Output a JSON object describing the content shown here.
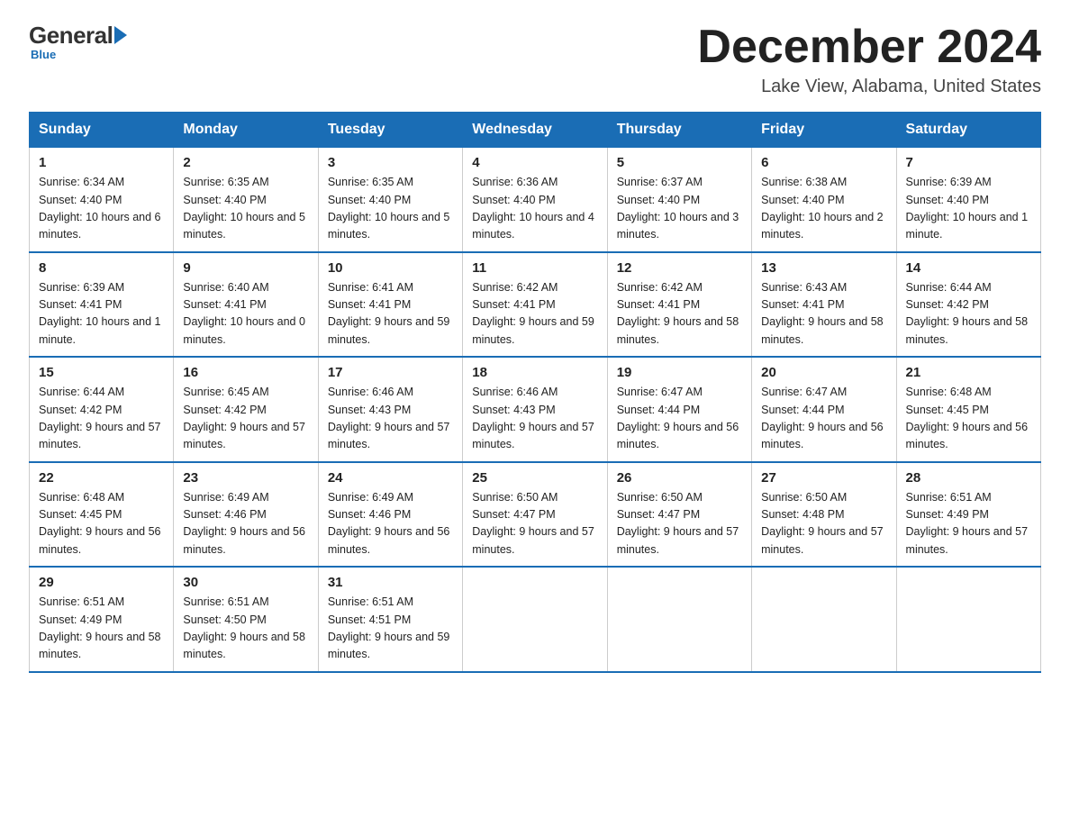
{
  "logo": {
    "general": "General",
    "blue": "Blue",
    "subtitle": "Blue"
  },
  "header": {
    "month": "December 2024",
    "location": "Lake View, Alabama, United States"
  },
  "days_of_week": [
    "Sunday",
    "Monday",
    "Tuesday",
    "Wednesday",
    "Thursday",
    "Friday",
    "Saturday"
  ],
  "weeks": [
    [
      {
        "day": "1",
        "sunrise": "6:34 AM",
        "sunset": "4:40 PM",
        "daylight": "10 hours and 6 minutes."
      },
      {
        "day": "2",
        "sunrise": "6:35 AM",
        "sunset": "4:40 PM",
        "daylight": "10 hours and 5 minutes."
      },
      {
        "day": "3",
        "sunrise": "6:35 AM",
        "sunset": "4:40 PM",
        "daylight": "10 hours and 5 minutes."
      },
      {
        "day": "4",
        "sunrise": "6:36 AM",
        "sunset": "4:40 PM",
        "daylight": "10 hours and 4 minutes."
      },
      {
        "day": "5",
        "sunrise": "6:37 AM",
        "sunset": "4:40 PM",
        "daylight": "10 hours and 3 minutes."
      },
      {
        "day": "6",
        "sunrise": "6:38 AM",
        "sunset": "4:40 PM",
        "daylight": "10 hours and 2 minutes."
      },
      {
        "day": "7",
        "sunrise": "6:39 AM",
        "sunset": "4:40 PM",
        "daylight": "10 hours and 1 minute."
      }
    ],
    [
      {
        "day": "8",
        "sunrise": "6:39 AM",
        "sunset": "4:41 PM",
        "daylight": "10 hours and 1 minute."
      },
      {
        "day": "9",
        "sunrise": "6:40 AM",
        "sunset": "4:41 PM",
        "daylight": "10 hours and 0 minutes."
      },
      {
        "day": "10",
        "sunrise": "6:41 AM",
        "sunset": "4:41 PM",
        "daylight": "9 hours and 59 minutes."
      },
      {
        "day": "11",
        "sunrise": "6:42 AM",
        "sunset": "4:41 PM",
        "daylight": "9 hours and 59 minutes."
      },
      {
        "day": "12",
        "sunrise": "6:42 AM",
        "sunset": "4:41 PM",
        "daylight": "9 hours and 58 minutes."
      },
      {
        "day": "13",
        "sunrise": "6:43 AM",
        "sunset": "4:41 PM",
        "daylight": "9 hours and 58 minutes."
      },
      {
        "day": "14",
        "sunrise": "6:44 AM",
        "sunset": "4:42 PM",
        "daylight": "9 hours and 58 minutes."
      }
    ],
    [
      {
        "day": "15",
        "sunrise": "6:44 AM",
        "sunset": "4:42 PM",
        "daylight": "9 hours and 57 minutes."
      },
      {
        "day": "16",
        "sunrise": "6:45 AM",
        "sunset": "4:42 PM",
        "daylight": "9 hours and 57 minutes."
      },
      {
        "day": "17",
        "sunrise": "6:46 AM",
        "sunset": "4:43 PM",
        "daylight": "9 hours and 57 minutes."
      },
      {
        "day": "18",
        "sunrise": "6:46 AM",
        "sunset": "4:43 PM",
        "daylight": "9 hours and 57 minutes."
      },
      {
        "day": "19",
        "sunrise": "6:47 AM",
        "sunset": "4:44 PM",
        "daylight": "9 hours and 56 minutes."
      },
      {
        "day": "20",
        "sunrise": "6:47 AM",
        "sunset": "4:44 PM",
        "daylight": "9 hours and 56 minutes."
      },
      {
        "day": "21",
        "sunrise": "6:48 AM",
        "sunset": "4:45 PM",
        "daylight": "9 hours and 56 minutes."
      }
    ],
    [
      {
        "day": "22",
        "sunrise": "6:48 AM",
        "sunset": "4:45 PM",
        "daylight": "9 hours and 56 minutes."
      },
      {
        "day": "23",
        "sunrise": "6:49 AM",
        "sunset": "4:46 PM",
        "daylight": "9 hours and 56 minutes."
      },
      {
        "day": "24",
        "sunrise": "6:49 AM",
        "sunset": "4:46 PM",
        "daylight": "9 hours and 56 minutes."
      },
      {
        "day": "25",
        "sunrise": "6:50 AM",
        "sunset": "4:47 PM",
        "daylight": "9 hours and 57 minutes."
      },
      {
        "day": "26",
        "sunrise": "6:50 AM",
        "sunset": "4:47 PM",
        "daylight": "9 hours and 57 minutes."
      },
      {
        "day": "27",
        "sunrise": "6:50 AM",
        "sunset": "4:48 PM",
        "daylight": "9 hours and 57 minutes."
      },
      {
        "day": "28",
        "sunrise": "6:51 AM",
        "sunset": "4:49 PM",
        "daylight": "9 hours and 57 minutes."
      }
    ],
    [
      {
        "day": "29",
        "sunrise": "6:51 AM",
        "sunset": "4:49 PM",
        "daylight": "9 hours and 58 minutes."
      },
      {
        "day": "30",
        "sunrise": "6:51 AM",
        "sunset": "4:50 PM",
        "daylight": "9 hours and 58 minutes."
      },
      {
        "day": "31",
        "sunrise": "6:51 AM",
        "sunset": "4:51 PM",
        "daylight": "9 hours and 59 minutes."
      },
      null,
      null,
      null,
      null
    ]
  ]
}
